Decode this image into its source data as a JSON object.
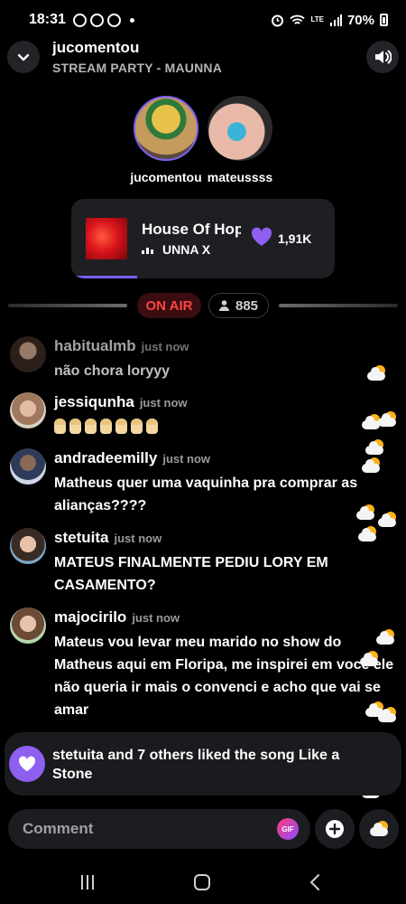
{
  "status_bar": {
    "time": "18:31",
    "network": "LTE",
    "battery": "70%"
  },
  "header": {
    "title": "jucomentou",
    "subtitle": "STREAM PARTY - MAUNNA"
  },
  "hosts": [
    {
      "name": "jucomentou"
    },
    {
      "name": "mateussss"
    }
  ],
  "now_playing": {
    "title": "House Of Hope",
    "artist": "UNNA X",
    "likes": "1,91K",
    "progress_pct": 25
  },
  "live": {
    "badge": "ON AIR",
    "viewers": "885"
  },
  "chat": [
    {
      "user": "habitualmb",
      "time": "just now",
      "text": "não chora loryyy"
    },
    {
      "user": "jessiqunha",
      "time": "just now",
      "emoji_count": 7
    },
    {
      "user": "andradeemilly",
      "time": "just now",
      "text": "Matheus quer uma vaquinha pra comprar as alianças????"
    },
    {
      "user": "stetuita",
      "time": "just now",
      "text": "MATEUS FINALMENTE PEDIU LORY EM CASAMENTO?"
    },
    {
      "user": "majocirilo",
      "time": "just now",
      "text": "Mateus vou levar meu marido no show do Matheus aqui em Floripa, me inspirei em você ele não queria ir mais o convenci e acho que vai se amar"
    }
  ],
  "notification": {
    "text": "stetuita and 7 others liked the song Like a Stone"
  },
  "composer": {
    "placeholder": "Comment",
    "gif_label": "GIF"
  },
  "colors": {
    "accent": "#8f5ff0",
    "on_air": "#ff4444",
    "background": "#000000"
  }
}
